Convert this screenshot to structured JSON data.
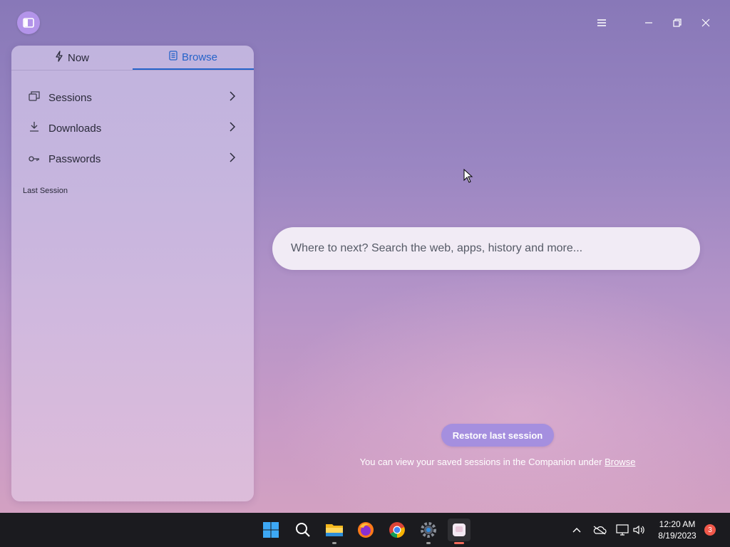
{
  "window": {
    "logo_icon": "sidebar-toggle-icon",
    "controls": [
      "menu-icon",
      "minimize-icon",
      "restore-icon",
      "close-icon"
    ]
  },
  "companion": {
    "tabs": [
      {
        "label": "Now",
        "icon": "lightning-icon",
        "active": false
      },
      {
        "label": "Browse",
        "icon": "document-icon",
        "active": true
      }
    ],
    "items": [
      {
        "label": "Sessions",
        "icon": "sessions-icon"
      },
      {
        "label": "Downloads",
        "icon": "download-icon"
      },
      {
        "label": "Passwords",
        "icon": "key-icon"
      }
    ],
    "section_label": "Last Session"
  },
  "search": {
    "placeholder": "Where to next? Search the web, apps, history and more..."
  },
  "restore": {
    "button_label": "Restore last session",
    "hint_text": "You can view your saved sessions in the Companion under ",
    "hint_link": "Browse"
  },
  "taskbar": {
    "apps": [
      "windows-start-icon",
      "search-icon",
      "file-explorer-icon",
      "firefox-icon",
      "chrome-icon",
      "settings-icon",
      "browser-app-icon"
    ],
    "time": "12:20 AM",
    "date": "8/19/2023",
    "notification_count": "3"
  },
  "colors": {
    "accent": "#2563c9",
    "button": "#a58fdf",
    "taskbar": "#1b1b1f"
  }
}
